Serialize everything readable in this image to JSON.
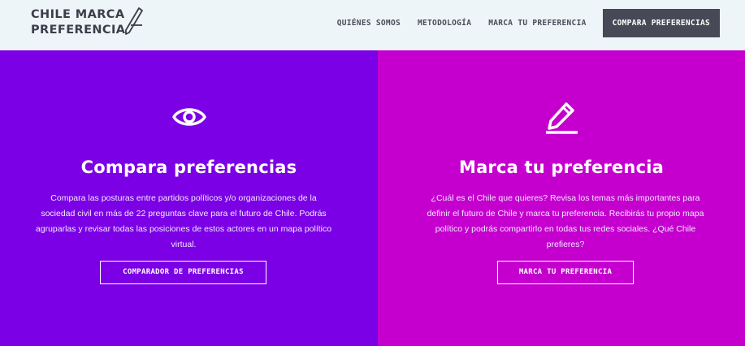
{
  "header": {
    "logo_line1": "CHILE MARCA",
    "logo_line2": "PREFERENCIA",
    "nav": [
      {
        "label": "QUIÉNES SOMOS"
      },
      {
        "label": "METODOLOGÍA"
      },
      {
        "label": "MARCA TU PREFERENCIA"
      }
    ],
    "cta_label": "COMPARA PREFERENCIAS"
  },
  "left_panel": {
    "icon": "eye-icon",
    "color": "#7b00e6",
    "title": "Compara preferencias",
    "description": "Compara las posturas entre partidos políticos y/o organizaciones de la sociedad civil en más de 22 preguntas clave para el futuro de Chile. Podrás agruparlas y revisar todas las posiciones de estos actores en un mapa político virtual.",
    "button_label": "COMPARADOR DE PREFERENCIAS"
  },
  "right_panel": {
    "icon": "pencil-icon",
    "color": "#c500cf",
    "title": "Marca tu preferencia",
    "description": "¿Cuál es el Chile que quieres? Revisa los temas más importantes para definir el futuro de Chile y marca tu preferencia. Recibirás tu propio mapa político y podrás compartirlo en todas tus redes sociales. ¿Qué Chile prefieres?",
    "button_label": "MARCA TU PREFERENCIA"
  }
}
